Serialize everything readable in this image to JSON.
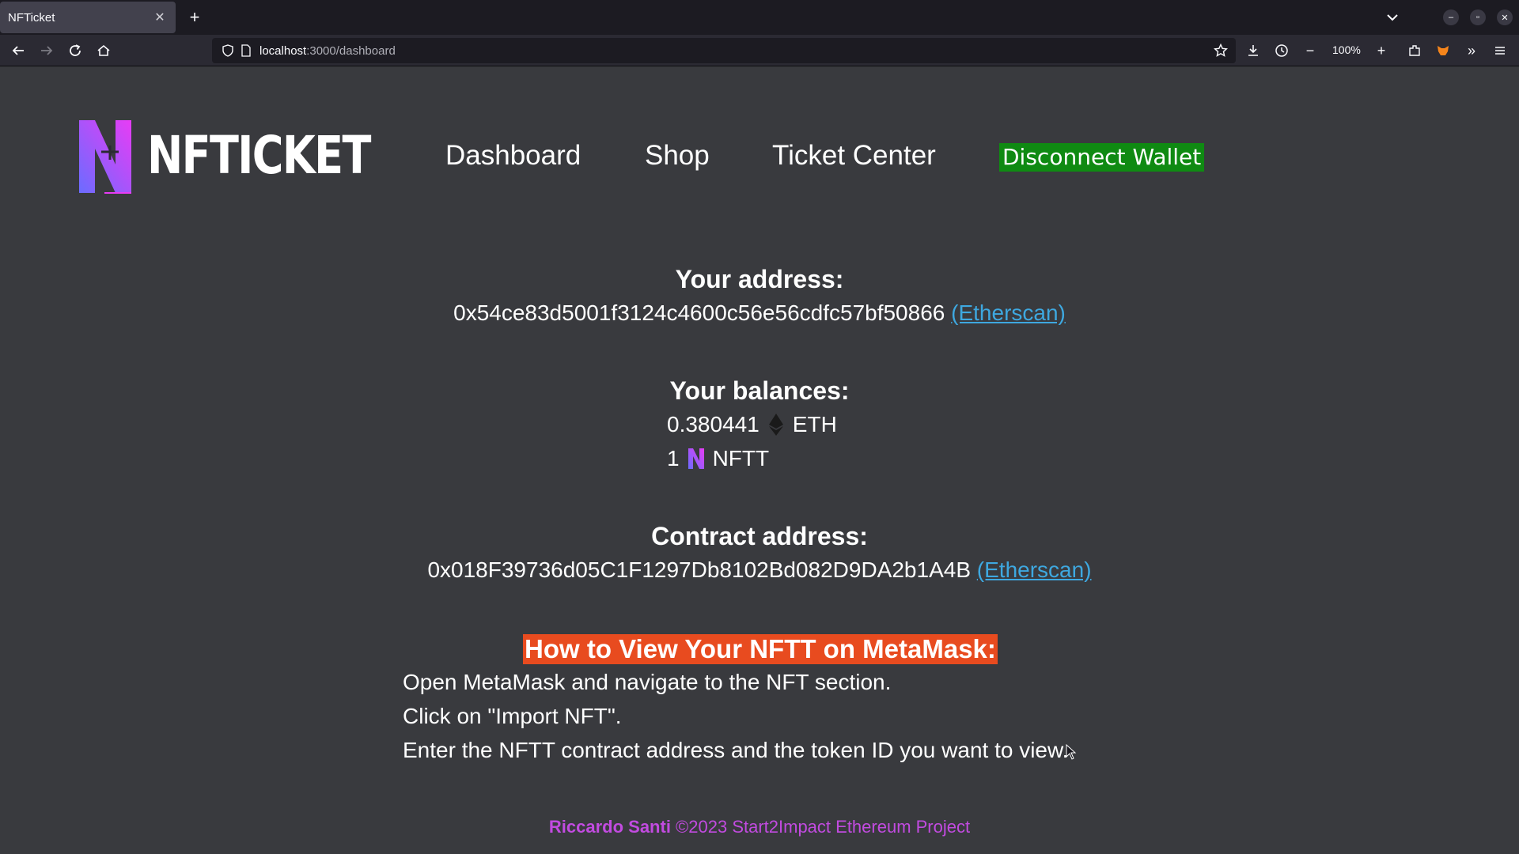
{
  "browser": {
    "tab_title": "NFTicket",
    "url_host": "localhost",
    "url_path": ":3000/dashboard",
    "zoom": "100%"
  },
  "app": {
    "logo_text": "NFTICKET",
    "nav": {
      "dashboard": "Dashboard",
      "shop": "Shop",
      "ticket_center": "Ticket Center",
      "disconnect": "Disconnect Wallet"
    }
  },
  "account": {
    "address_heading": "Your address:",
    "address": "0x54ce83d5001f3124c4600c56e56cdfc57bf50866",
    "address_link": "(Etherscan)",
    "balances_heading": "Your balances:",
    "eth_amount": "0.380441",
    "eth_unit": "ETH",
    "nftt_amount": "1",
    "nftt_unit": "NFTT",
    "contract_heading": "Contract address:",
    "contract": "0x018F39736d05C1F1297Db8102Bd082D9DA2b1A4B",
    "contract_link": "(Etherscan)"
  },
  "howto": {
    "title": "How to View Your NFTT on MetaMask:",
    "steps": [
      "Open MetaMask and navigate to the NFT section.",
      "Click on \"Import NFT\".",
      "Enter the NFTT contract address and the token ID you want to view."
    ]
  },
  "footer": {
    "author": "Riccardo Santi",
    "text": " ©2023 Start2Impact Ethereum Project"
  },
  "colors": {
    "background": "#393a3e",
    "disconnect_bg": "#0f8a12",
    "howto_bg": "#e84b1f",
    "link": "#3ea8e0",
    "footer": "#c24be0",
    "logo_gradient": [
      "#7a5cff",
      "#e040fb"
    ]
  }
}
